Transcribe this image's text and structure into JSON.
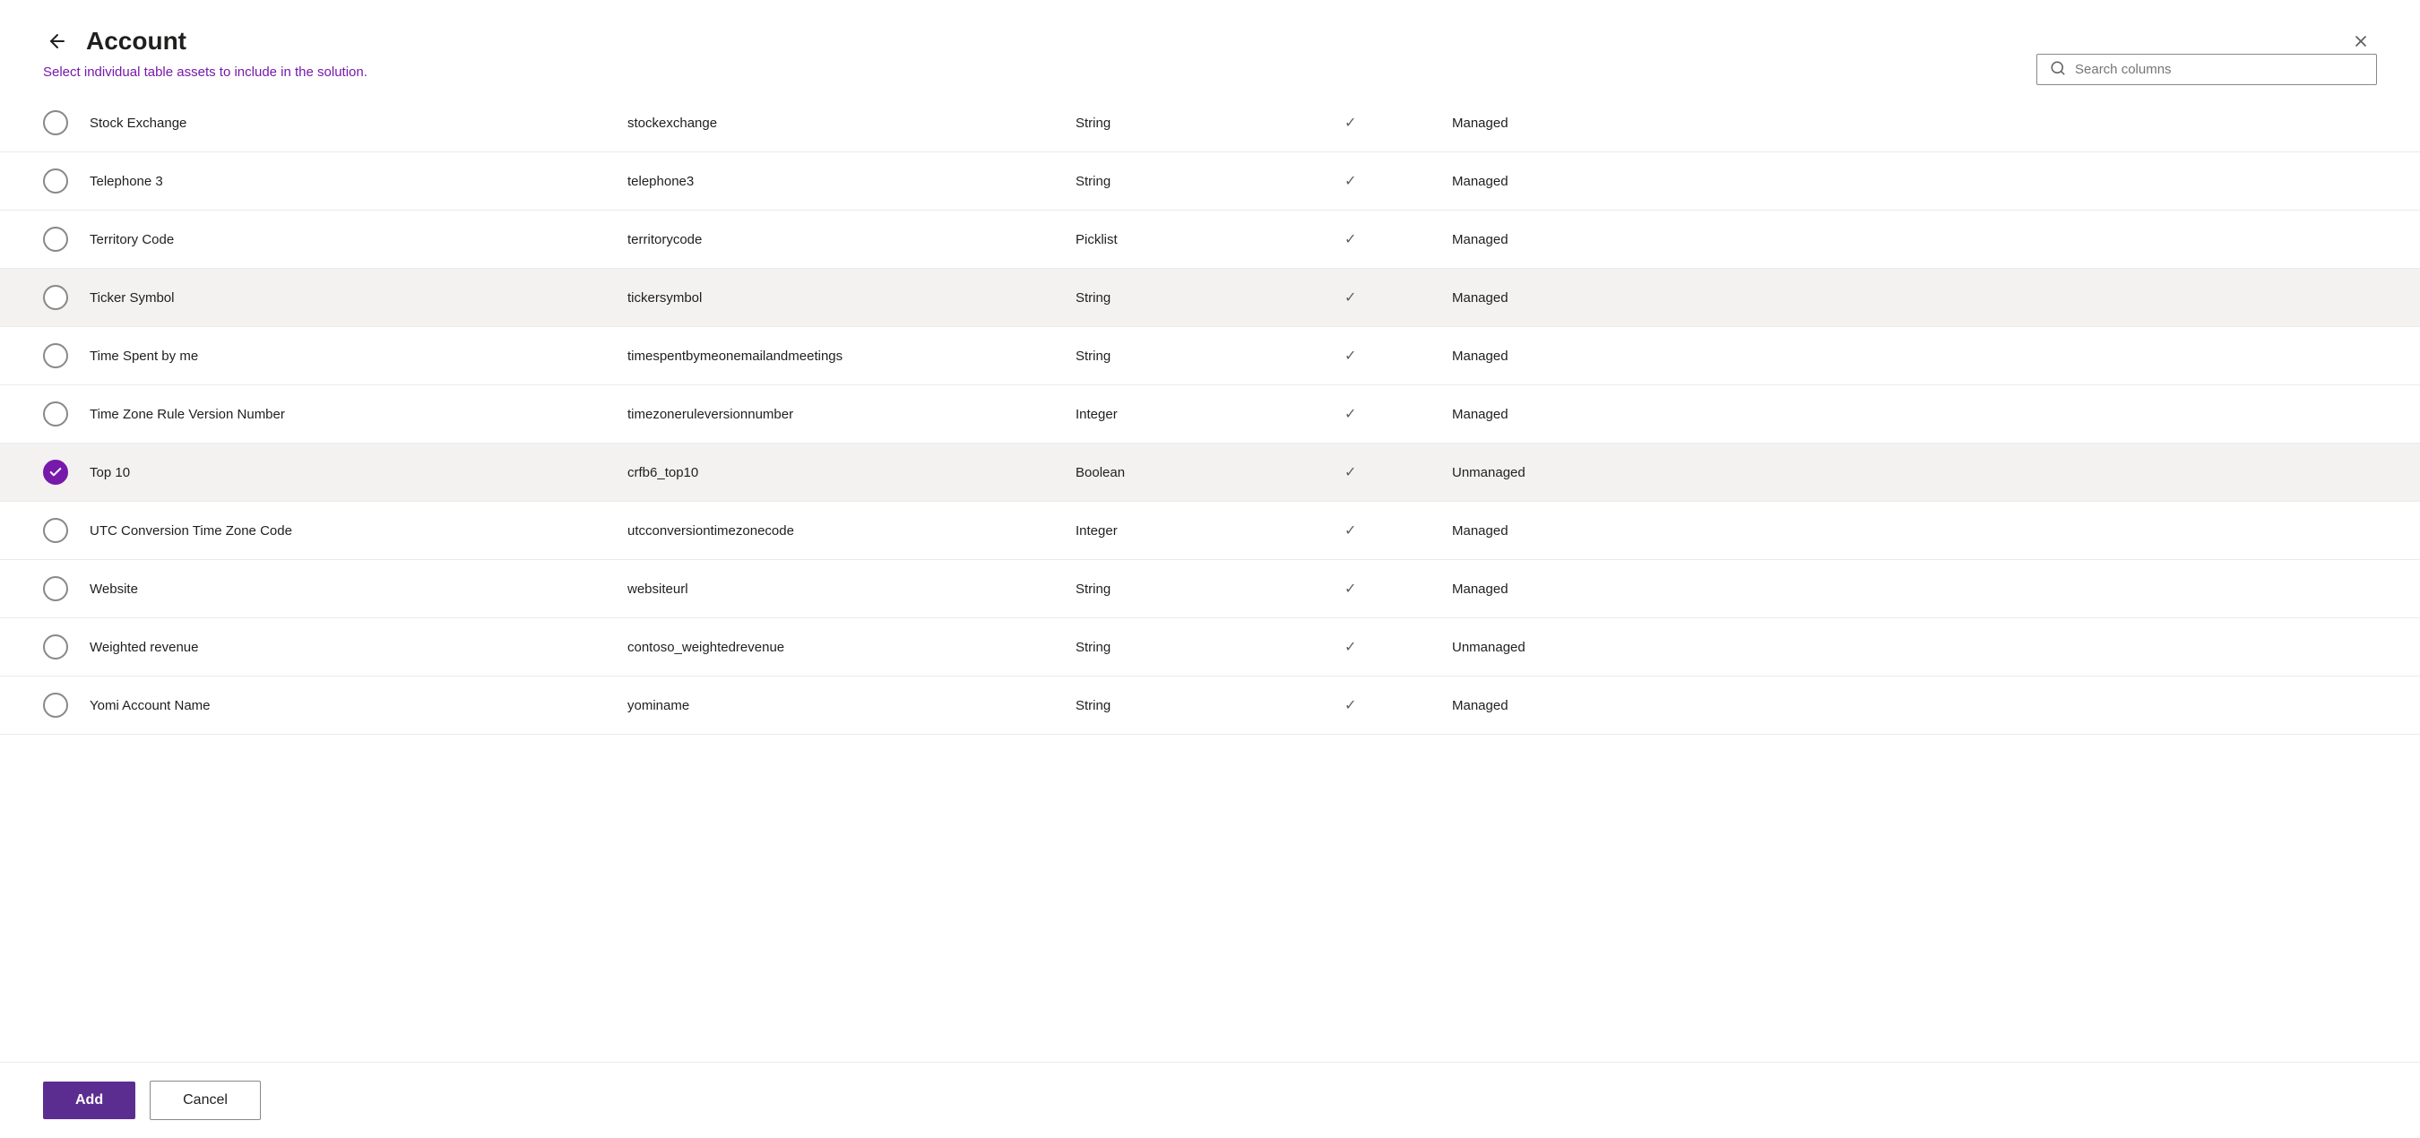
{
  "dialog": {
    "title": "Account",
    "subtitle_static": "Select ",
    "subtitle_link": "individual table assets",
    "subtitle_rest": " to include in the solution.",
    "close_label": "Close",
    "back_label": "Back"
  },
  "search": {
    "placeholder": "Search columns",
    "value": ""
  },
  "rows": [
    {
      "id": 1,
      "checked": false,
      "name": "Stock Exchange",
      "schema": "stockexchange",
      "type": "String",
      "has_check": true,
      "managed": "Managed"
    },
    {
      "id": 2,
      "checked": false,
      "name": "Telephone 3",
      "schema": "telephone3",
      "type": "String",
      "has_check": true,
      "managed": "Managed"
    },
    {
      "id": 3,
      "checked": false,
      "name": "Territory Code",
      "schema": "territorycode",
      "type": "Picklist",
      "has_check": true,
      "managed": "Managed"
    },
    {
      "id": 4,
      "checked": false,
      "name": "Ticker Symbol",
      "schema": "tickersymbol",
      "type": "String",
      "has_check": true,
      "managed": "Managed",
      "row_selected": true
    },
    {
      "id": 5,
      "checked": false,
      "name": "Time Spent by me",
      "schema": "timespentbymeonemailandmeetings",
      "type": "String",
      "has_check": true,
      "managed": "Managed"
    },
    {
      "id": 6,
      "checked": false,
      "name": "Time Zone Rule Version Number",
      "schema": "timezoneruleversionnumber",
      "type": "Integer",
      "has_check": true,
      "managed": "Managed"
    },
    {
      "id": 7,
      "checked": true,
      "name": "Top 10",
      "schema": "crfb6_top10",
      "type": "Boolean",
      "has_check": true,
      "managed": "Unmanaged",
      "row_selected": true
    },
    {
      "id": 8,
      "checked": false,
      "name": "UTC Conversion Time Zone Code",
      "schema": "utcconversiontimezonecode",
      "type": "Integer",
      "has_check": true,
      "managed": "Managed"
    },
    {
      "id": 9,
      "checked": false,
      "name": "Website",
      "schema": "websiteurl",
      "type": "String",
      "has_check": true,
      "managed": "Managed"
    },
    {
      "id": 10,
      "checked": false,
      "name": "Weighted revenue",
      "schema": "contoso_weightedrevenue",
      "type": "String",
      "has_check": true,
      "managed": "Unmanaged"
    },
    {
      "id": 11,
      "checked": false,
      "name": "Yomi Account Name",
      "schema": "yominame",
      "type": "String",
      "has_check": true,
      "managed": "Managed"
    }
  ],
  "footer": {
    "add_label": "Add",
    "cancel_label": "Cancel"
  }
}
